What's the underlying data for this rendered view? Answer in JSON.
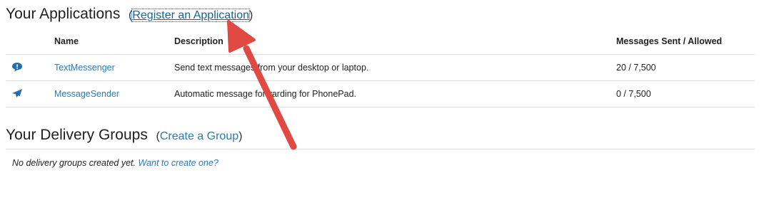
{
  "applications": {
    "title": "Your Applications",
    "open_paren": "(",
    "register_link": "Register an Application",
    "close_paren": ")",
    "columns": {
      "name": "Name",
      "description": "Description",
      "messages": "Messages Sent / Allowed"
    },
    "rows": [
      {
        "icon": "chat-bubble-icon",
        "name": "TextMessenger",
        "description": "Send text messages from your desktop or laptop.",
        "messages": "20 / 7,500"
      },
      {
        "icon": "paper-plane-icon",
        "name": "MessageSender",
        "description": "Automatic message forwarding for PhonePad.",
        "messages": "0 / 7,500"
      }
    ]
  },
  "groups": {
    "title": "Your Delivery Groups",
    "open_paren": "(",
    "create_link": "Create a Group",
    "close_paren": ")",
    "empty_text": "No delivery groups created yet.",
    "empty_link": "Want to create one?"
  },
  "colors": {
    "link": "#2a7ab8",
    "icon": "#1f6fb2",
    "annotation_arrow": "#e04a43"
  }
}
